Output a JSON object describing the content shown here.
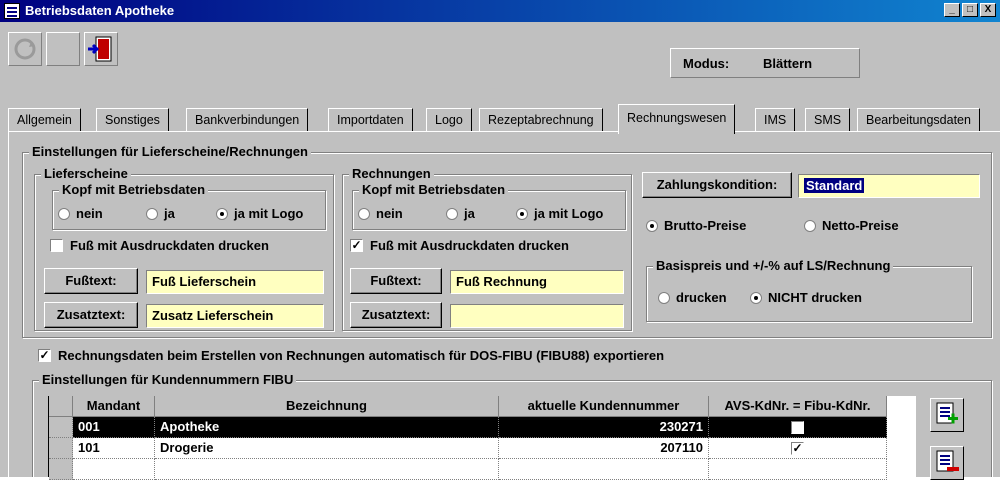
{
  "window": {
    "title": "Betriebsdaten Apotheke",
    "controls": [
      "_",
      "□",
      "X"
    ]
  },
  "toolbar": {
    "icons": [
      "refresh-icon",
      "blank-icon",
      "exit-door-icon"
    ],
    "modus_label": "Modus:",
    "modus_value": "Blättern"
  },
  "tabs": [
    {
      "label": "Allgemein"
    },
    {
      "label": "Sonstiges"
    },
    {
      "label": "Bankverbindungen"
    },
    {
      "label": "Importdaten"
    },
    {
      "label": "Logo"
    },
    {
      "label": "Rezeptabrechnung"
    },
    {
      "label": "Rechnungswesen",
      "active": true
    },
    {
      "label": "IMS"
    },
    {
      "label": "SMS"
    },
    {
      "label": "Bearbeitungsdaten"
    }
  ],
  "settings": {
    "title": "Einstellungen für Lieferscheine/Rechnungen",
    "lieferscheine": {
      "title": "Lieferscheine",
      "kopf_title": "Kopf mit Betriebsdaten",
      "radios": [
        "nein",
        "ja",
        "ja mit Logo"
      ],
      "selected": "ja mit Logo",
      "fuss_check_label": "Fuß mit Ausdruckdaten drucken",
      "fuss_checked": false,
      "fusstext_button": "Fußtext:",
      "fusstext_value": "Fuß Lieferschein",
      "zusatztext_button": "Zusatztext:",
      "zusatztext_value": "Zusatz Lieferschein"
    },
    "rechnungen": {
      "title": "Rechnungen",
      "kopf_title": "Kopf mit Betriebsdaten",
      "radios": [
        "nein",
        "ja",
        "ja mit Logo"
      ],
      "selected": "ja mit Logo",
      "fuss_check_label": "Fuß mit Ausdruckdaten drucken",
      "fuss_checked": true,
      "fusstext_button": "Fußtext:",
      "fusstext_value": "Fuß Rechnung",
      "zusatztext_button": "Zusatztext:",
      "zusatztext_value": ""
    },
    "zahlung": {
      "button": "Zahlungskondition:",
      "value": "Standard",
      "preis_options": [
        "Brutto-Preise",
        "Netto-Preise"
      ],
      "preis_selected": "Brutto-Preise",
      "basis_title": "Basispreis und +/-% auf LS/Rechnung",
      "basis_options": [
        "drucken",
        "NICHT drucken"
      ],
      "basis_selected": "NICHT drucken"
    }
  },
  "export_check": {
    "label": "Rechnungsdaten beim Erstellen von Rechnungen automatisch für DOS-FIBU (FIBU88) exportieren",
    "checked": true
  },
  "fibu": {
    "title": "Einstellungen für Kundennummern FIBU",
    "columns": [
      "Mandant",
      "Bezeichnung",
      "aktuelle Kundennummer",
      "AVS-KdNr. = Fibu-KdNr."
    ],
    "rows": [
      {
        "mandant": "001",
        "bezeichnung": "Apotheke",
        "nummer": "230271",
        "avs": false,
        "selected": true
      },
      {
        "mandant": "101",
        "bezeichnung": "Drogerie",
        "nummer": "207110",
        "avs": true,
        "selected": false
      }
    ],
    "side_buttons": [
      "add-row-icon",
      "delete-row-icon"
    ]
  }
}
